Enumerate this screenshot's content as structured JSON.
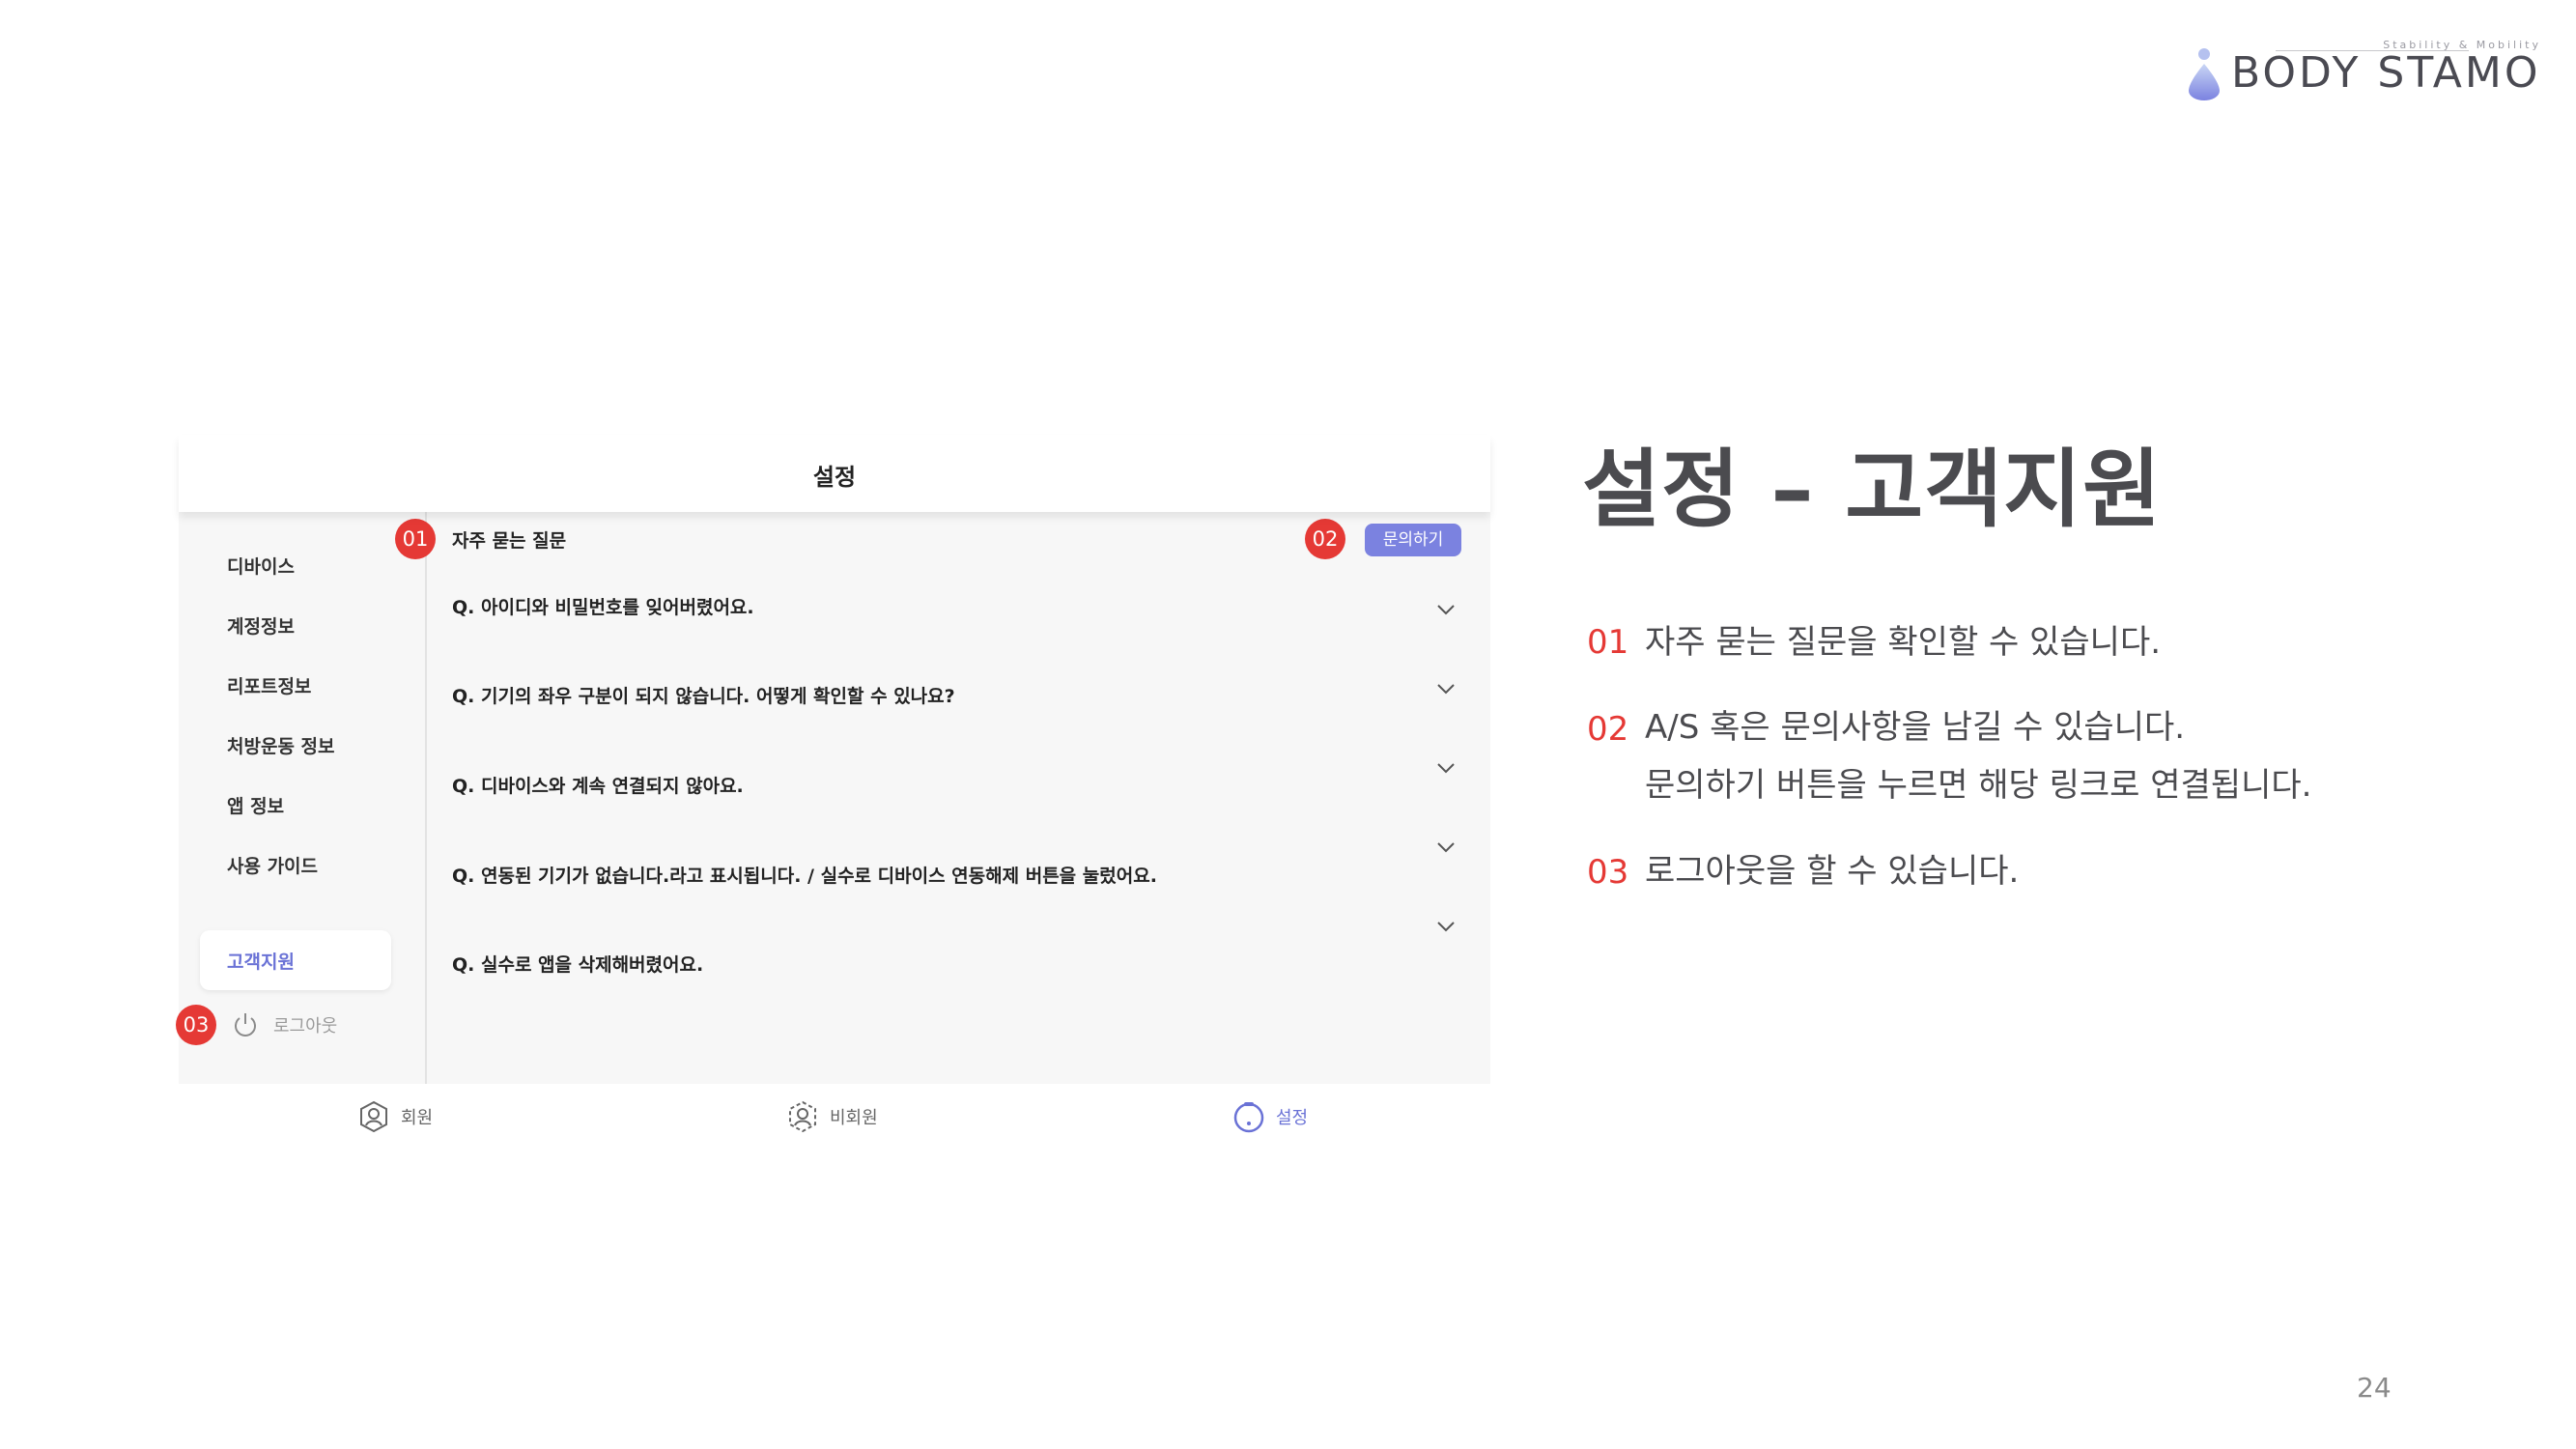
{
  "logo": {
    "wordmark": "BODY STAMO",
    "tagline": "Stability & Mobility"
  },
  "app": {
    "header_title": "설정",
    "sidebar": {
      "items": [
        {
          "label": "디바이스"
        },
        {
          "label": "계정정보"
        },
        {
          "label": "리포트정보"
        },
        {
          "label": "처방운동 정보"
        },
        {
          "label": "앱 정보"
        },
        {
          "label": "사용 가이드"
        },
        {
          "label": "고객지원",
          "active": true
        }
      ],
      "logout_label": "로그아웃"
    },
    "faq": {
      "title": "자주 묻는 질문",
      "inquiry_button": "문의하기",
      "questions": [
        "Q. 아이디와 비밀번호를 잊어버렸어요.",
        "Q. 기기의 좌우 구분이 되지 않습니다. 어떻게 확인할 수 있나요?",
        "Q. 디바이스와 계속 연결되지 않아요.",
        "Q. 연동된 기기가 없습니다.라고 표시됩니다. / 실수로 디바이스 연동해제 버튼을 눌렀어요.",
        "Q. 실수로 앱을 삭제해버렸어요."
      ]
    },
    "bottom_nav": [
      {
        "label": "회원",
        "icon": "member-icon"
      },
      {
        "label": "비회원",
        "icon": "guest-icon"
      },
      {
        "label": "설정",
        "icon": "settings-icon",
        "active": true
      }
    ]
  },
  "markers": {
    "m1": "01",
    "m2": "02",
    "m3": "03"
  },
  "slide": {
    "title": "설정 – 고객지원",
    "descriptions": [
      {
        "num": "01",
        "lines": [
          "자주 묻는 질문을 확인할 수 있습니다."
        ]
      },
      {
        "num": "02",
        "lines": [
          "A/S 혹은 문의사항을 남길 수 있습니다.",
          "문의하기 버튼을 누르면 해당 링크로 연결됩니다."
        ]
      },
      {
        "num": "03",
        "lines": [
          "로그아웃을 할 수 있습니다."
        ]
      }
    ],
    "page_number": "24"
  },
  "colors": {
    "accent": "#7b82e0",
    "marker": "#e53935",
    "title": "#4b4b4f"
  }
}
